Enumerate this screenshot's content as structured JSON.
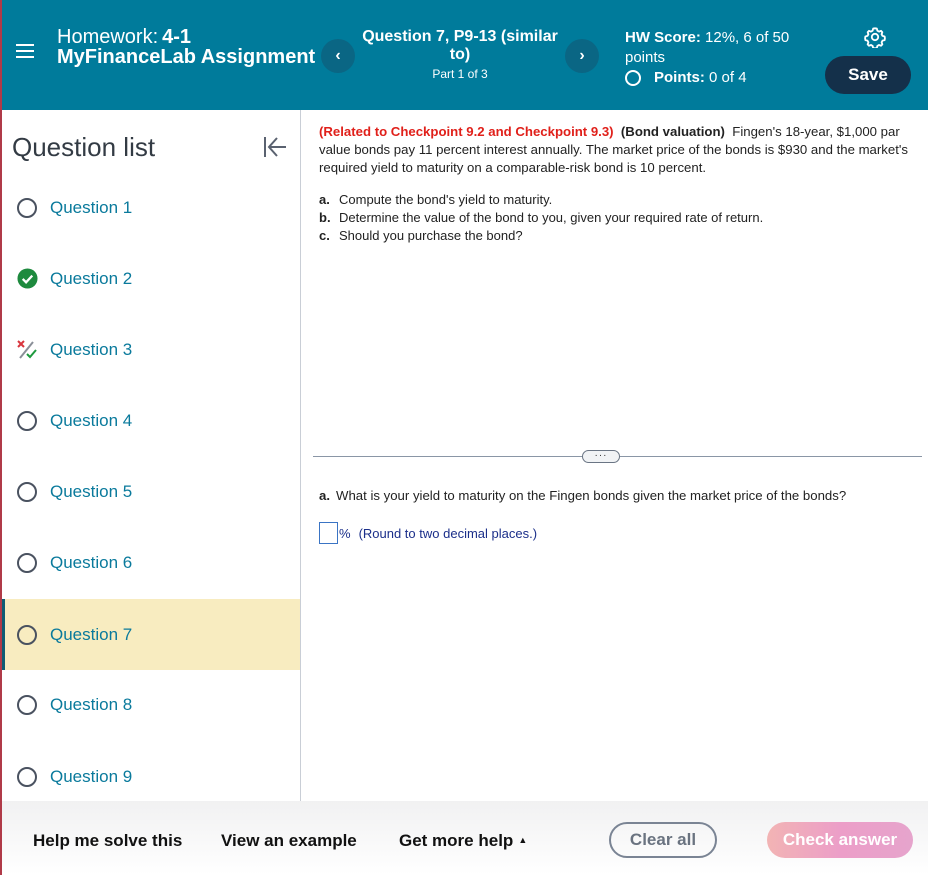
{
  "header": {
    "homework_label": "Homework:",
    "homework_number": "4-1",
    "assignment_name": "MyFinanceLab Assignment",
    "question_title": "Question 7, P9-13 (similar to)",
    "question_part": "Part 1 of 3",
    "prev_icon": "chevron-left-icon",
    "next_icon": "chevron-right-icon",
    "hw_score_label": "HW Score:",
    "hw_score_value": "12%, 6 of 50 points",
    "points_label": "Points:",
    "points_value": "0 of 4",
    "settings_icon": "gear-icon",
    "save_label": "Save"
  },
  "sidebar": {
    "title": "Question list",
    "collapse_icon": "collapse-left-icon",
    "items": [
      {
        "label": "Question 1",
        "status": "unanswered"
      },
      {
        "label": "Question 2",
        "status": "correct"
      },
      {
        "label": "Question 3",
        "status": "partial"
      },
      {
        "label": "Question 4",
        "status": "unanswered"
      },
      {
        "label": "Question 5",
        "status": "unanswered"
      },
      {
        "label": "Question 6",
        "status": "unanswered"
      },
      {
        "label": "Question 7",
        "status": "unanswered",
        "active": true
      },
      {
        "label": "Question 8",
        "status": "unanswered"
      },
      {
        "label": "Question 9",
        "status": "unanswered"
      }
    ]
  },
  "main": {
    "related": "(Related to Checkpoint 9.2 and Checkpoint 9.3)",
    "topic": "(Bond valuation)",
    "problem_text": "Fingen's 18-year, $1,000 par value bonds pay 11 percent interest annually.  The market price of the bonds is $930 and the market's required yield to maturity on a comparable-risk bond is 10 percent.",
    "parts": [
      {
        "letter": "a.",
        "text": "Compute the bond's yield to maturity."
      },
      {
        "letter": "b.",
        "text": "Determine the value of the bond to you, given your required rate of return."
      },
      {
        "letter": "c.",
        "text": "Should you purchase the bond?"
      }
    ],
    "more_button": "···",
    "current_part_letter": "a.",
    "current_question": "What is your yield to maturity on the Fingen bonds given the market price of the bonds?",
    "answer_value": "",
    "answer_unit": "%",
    "answer_hint": "(Round to two decimal places.)"
  },
  "footer": {
    "help_solve": "Help me solve this",
    "view_example": "View an example",
    "get_more_help": "Get more help",
    "clear_all": "Clear all",
    "check_answer": "Check answer"
  },
  "colors": {
    "header_bg": "#007b9b",
    "save_bg": "#14304a",
    "active_row_bg": "#f8ecc0",
    "link_color": "#0a7a9c",
    "related_red": "#e0201a",
    "correct_green": "#1e8a3e"
  }
}
